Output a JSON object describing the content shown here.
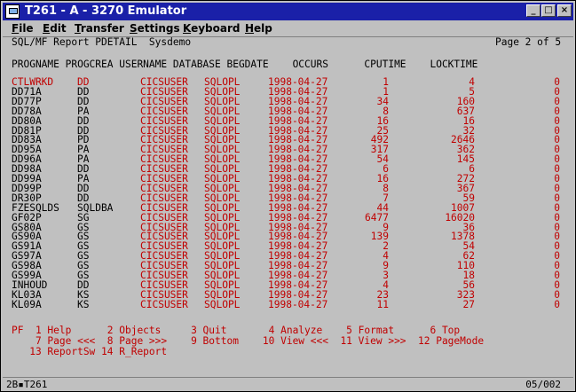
{
  "window": {
    "title": "T261 - A - 3270 Emulator",
    "buttons": {
      "minimize": "_",
      "maximize": "□",
      "close": "×"
    }
  },
  "menu": [
    {
      "label": "File",
      "u": "F",
      "rest": "ile"
    },
    {
      "label": "Edit",
      "u": "E",
      "rest": "dit"
    },
    {
      "label": "Transfer",
      "u": "T",
      "rest": "ransfer"
    },
    {
      "label": "Settings",
      "u": "S",
      "rest": "ettings"
    },
    {
      "label": "Keyboard",
      "u": "K",
      "rest": "eyboard"
    },
    {
      "label": "Help",
      "u": "H",
      "rest": "elp"
    }
  ],
  "report": {
    "header_left": "SQL/MF Report PDETAIL  Sysdemo",
    "header_right": "Page 2 of 5",
    "columns": "PROGNAME PROGCREA USERNAME DATABASE BEGDATE    OCCURS      CPUTIME    LOCKTIME",
    "rows": [
      {
        "prog": "CTLWRKD ",
        "crea": "DD",
        "user": "CICSUSER",
        "db": "SQLOPL",
        "date": "1998-04-27",
        "occurs": "1",
        "cpu": "4",
        "lock": "0",
        "highlight": true
      },
      {
        "prog": "DD71A   ",
        "crea": "DD",
        "user": "CICSUSER",
        "db": "SQLOPL",
        "date": "1998-04-27",
        "occurs": "1",
        "cpu": "5",
        "lock": "0",
        "highlight": false
      },
      {
        "prog": "DD77P   ",
        "crea": "DD",
        "user": "CICSUSER",
        "db": "SQLOPL",
        "date": "1998-04-27",
        "occurs": "34",
        "cpu": "160",
        "lock": "0",
        "highlight": false
      },
      {
        "prog": "DD78A   ",
        "crea": "PA",
        "user": "CICSUSER",
        "db": "SQLOPL",
        "date": "1998-04-27",
        "occurs": "8",
        "cpu": "637",
        "lock": "0",
        "highlight": false
      },
      {
        "prog": "DD80A   ",
        "crea": "DD",
        "user": "CICSUSER",
        "db": "SQLOPL",
        "date": "1998-04-27",
        "occurs": "16",
        "cpu": "16",
        "lock": "0",
        "highlight": false
      },
      {
        "prog": "DD81P   ",
        "crea": "DD",
        "user": "CICSUSER",
        "db": "SQLOPL",
        "date": "1998-04-27",
        "occurs": "25",
        "cpu": "32",
        "lock": "0",
        "highlight": false
      },
      {
        "prog": "DD83A   ",
        "crea": "PD",
        "user": "CICSUSER",
        "db": "SQLOPL",
        "date": "1998-04-27",
        "occurs": "492",
        "cpu": "2646",
        "lock": "0",
        "highlight": false
      },
      {
        "prog": "DD95A   ",
        "crea": "PA",
        "user": "CICSUSER",
        "db": "SQLOPL",
        "date": "1998-04-27",
        "occurs": "317",
        "cpu": "362",
        "lock": "0",
        "highlight": false
      },
      {
        "prog": "DD96A   ",
        "crea": "PA",
        "user": "CICSUSER",
        "db": "SQLOPL",
        "date": "1998-04-27",
        "occurs": "54",
        "cpu": "145",
        "lock": "0",
        "highlight": false
      },
      {
        "prog": "DD98A   ",
        "crea": "DD",
        "user": "CICSUSER",
        "db": "SQLOPL",
        "date": "1998-04-27",
        "occurs": "6",
        "cpu": "6",
        "lock": "0",
        "highlight": false
      },
      {
        "prog": "DD99A   ",
        "crea": "PA",
        "user": "CICSUSER",
        "db": "SQLOPL",
        "date": "1998-04-27",
        "occurs": "16",
        "cpu": "272",
        "lock": "0",
        "highlight": false
      },
      {
        "prog": "DD99P   ",
        "crea": "DD",
        "user": "CICSUSER",
        "db": "SQLOPL",
        "date": "1998-04-27",
        "occurs": "8",
        "cpu": "367",
        "lock": "0",
        "highlight": false
      },
      {
        "prog": "DR30P   ",
        "crea": "DD",
        "user": "CICSUSER",
        "db": "SQLOPL",
        "date": "1998-04-27",
        "occurs": "7",
        "cpu": "59",
        "lock": "0",
        "highlight": false
      },
      {
        "prog": "FZESQLDS",
        "crea": "SQLDBA",
        "user": "CICSUSER",
        "db": "SQLOPL",
        "date": "1998-04-27",
        "occurs": "44",
        "cpu": "1007",
        "lock": "0",
        "highlight": false
      },
      {
        "prog": "GF02P   ",
        "crea": "SG",
        "user": "CICSUSER",
        "db": "SQLOPL",
        "date": "1998-04-27",
        "occurs": "6477",
        "cpu": "16020",
        "lock": "0",
        "highlight": false
      },
      {
        "prog": "GS80A   ",
        "crea": "GS",
        "user": "CICSUSER",
        "db": "SQLOPL",
        "date": "1998-04-27",
        "occurs": "9",
        "cpu": "36",
        "lock": "0",
        "highlight": false
      },
      {
        "prog": "GS90A   ",
        "crea": "GS",
        "user": "CICSUSER",
        "db": "SQLOPL",
        "date": "1998-04-27",
        "occurs": "139",
        "cpu": "1378",
        "lock": "0",
        "highlight": false
      },
      {
        "prog": "GS91A   ",
        "crea": "GS",
        "user": "CICSUSER",
        "db": "SQLOPL",
        "date": "1998-04-27",
        "occurs": "2",
        "cpu": "54",
        "lock": "0",
        "highlight": false
      },
      {
        "prog": "GS97A   ",
        "crea": "GS",
        "user": "CICSUSER",
        "db": "SQLOPL",
        "date": "1998-04-27",
        "occurs": "4",
        "cpu": "62",
        "lock": "0",
        "highlight": false
      },
      {
        "prog": "GS98A   ",
        "crea": "GS",
        "user": "CICSUSER",
        "db": "SQLOPL",
        "date": "1998-04-27",
        "occurs": "9",
        "cpu": "110",
        "lock": "0",
        "highlight": false
      },
      {
        "prog": "GS99A   ",
        "crea": "GS",
        "user": "CICSUSER",
        "db": "SQLOPL",
        "date": "1998-04-27",
        "occurs": "3",
        "cpu": "18",
        "lock": "0",
        "highlight": false
      },
      {
        "prog": "INHOUD  ",
        "crea": "DD",
        "user": "CICSUSER",
        "db": "SQLOPL",
        "date": "1998-04-27",
        "occurs": "4",
        "cpu": "56",
        "lock": "0",
        "highlight": false
      },
      {
        "prog": "KL03A   ",
        "crea": "KS",
        "user": "CICSUSER",
        "db": "SQLOPL",
        "date": "1998-04-27",
        "occurs": "23",
        "cpu": "323",
        "lock": "0",
        "highlight": false
      },
      {
        "prog": "KL09A   ",
        "crea": "KS",
        "user": "CICSUSER",
        "db": "SQLOPL",
        "date": "1998-04-27",
        "occurs": "11",
        "cpu": "27",
        "lock": "0",
        "highlight": false
      }
    ],
    "pf_line1": "PF  1 Help      2 Objects     3 Quit       4 Analyze    5 Format      6 Top",
    "pf_line2": "    7 Page <<<  8 Page >>>    9 Bottom    10 View <<<  11 View >>>  12 PageMode",
    "pf_line3": "   13 ReportSw 14 R_Report"
  },
  "status": {
    "left": "2B",
    "session": "T261",
    "right": "05/002"
  }
}
